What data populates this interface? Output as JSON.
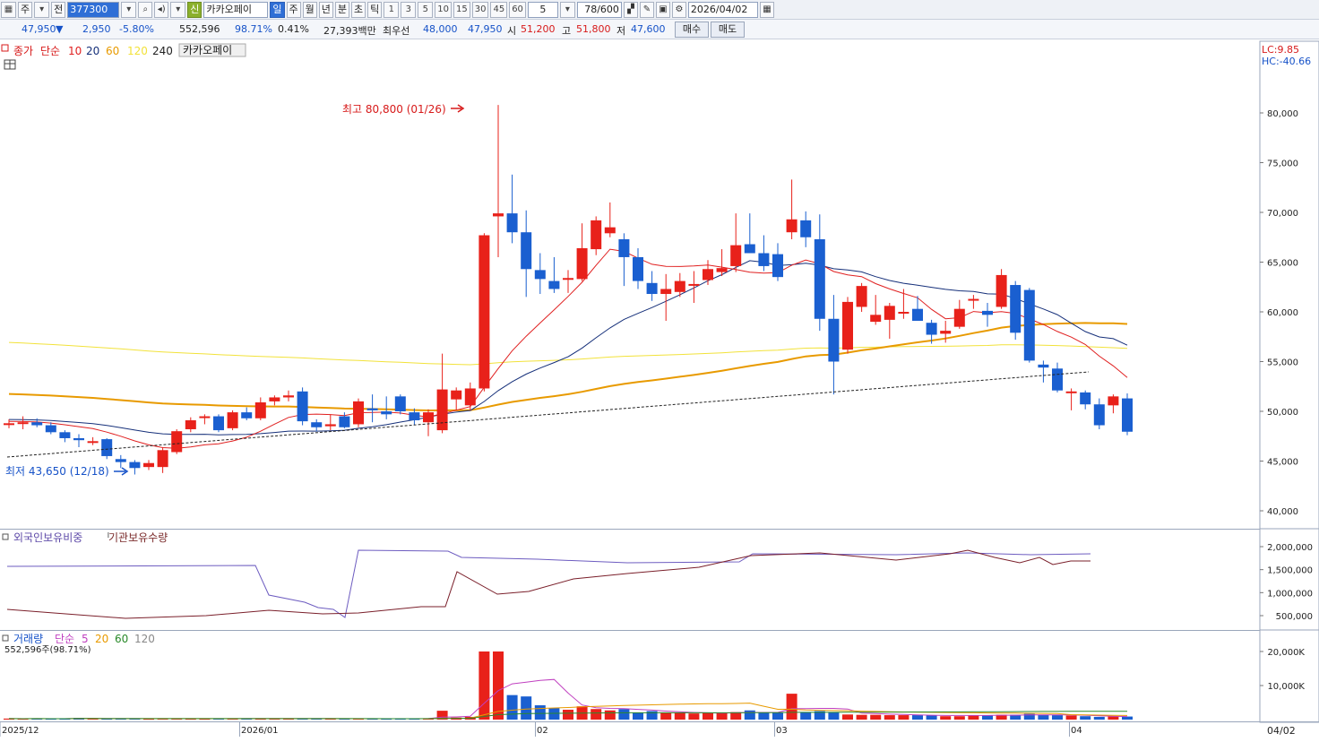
{
  "toolbar": {
    "type_select": "주",
    "scope_select": "전",
    "code": "377300",
    "stock_badge": "신",
    "stock_name": "카카오페이",
    "periods": [
      "일",
      "주",
      "월",
      "년",
      "분",
      "초",
      "틱"
    ],
    "active_period": "일",
    "intervals": [
      "1",
      "3",
      "5",
      "10",
      "15",
      "30",
      "45",
      "60"
    ],
    "interval_value": "5",
    "zoom": "78/600",
    "date": "2026/04/02"
  },
  "quote": {
    "price": "47,950",
    "direction": "▼",
    "change": "2,950",
    "change_pct": "-5.80%",
    "volume": "552,596",
    "volume_ratio": "98.71%",
    "turnover_pct": "0.41%",
    "amount": "27,393백만",
    "best_bid_label": "최우선",
    "best_ask": "48,000",
    "best_bid": "47,950",
    "open_label": "시",
    "open": "51,200",
    "high_label": "고",
    "high": "51,800",
    "low_label": "저",
    "low": "47,600",
    "buy_label": "매수",
    "sell_label": "매도"
  },
  "price_panel": {
    "legend_close": "종가",
    "legend_simple": "단순",
    "ma_labels": [
      "10",
      "20",
      "60",
      "120",
      "240"
    ],
    "stock_label": "카카오페이",
    "lc": "LC:9.85",
    "hc": "HC:-40.66",
    "high_annotation": "최고 80,800 (01/26)",
    "low_annotation": "최저 43,650 (12/18)",
    "ma_colors": {
      "10": "#e02020",
      "20": "#16307a",
      "60": "#e89a00",
      "120": "#f2e23a",
      "240": "#222222"
    }
  },
  "foreign_panel": {
    "legend1": "외국인보유비중",
    "legend2": "기관보유수량",
    "y_ticks": [
      "2,000,000",
      "1,500,000",
      "1,000,000",
      "500,000"
    ]
  },
  "volume_panel": {
    "legend_volume": "거래량",
    "legend_simple": "단순",
    "ma_labels": [
      "5",
      "20",
      "60",
      "120"
    ],
    "volume_info": "552,596주(98.71%)",
    "y_ticks": [
      "20,000K",
      "10,000K"
    ]
  },
  "x_axis": {
    "labels": [
      "2025/12",
      "2026/01",
      "02",
      "03",
      "04",
      "04/02"
    ]
  },
  "chart_data": {
    "type": "candlestick",
    "y_axis_ticks": [
      80000,
      75000,
      70000,
      65000,
      60000,
      55000,
      50000,
      45000,
      40000
    ],
    "ylim": [
      38000,
      82000
    ],
    "candles": [
      {
        "o": 48700,
        "h": 49200,
        "l": 48300,
        "c": 48800
      },
      {
        "o": 48800,
        "h": 49500,
        "l": 48200,
        "c": 48900
      },
      {
        "o": 48900,
        "h": 49300,
        "l": 48400,
        "c": 48600
      },
      {
        "o": 48600,
        "h": 48900,
        "l": 47700,
        "c": 47900
      },
      {
        "o": 47900,
        "h": 48100,
        "l": 46900,
        "c": 47300
      },
      {
        "o": 47300,
        "h": 47700,
        "l": 46400,
        "c": 47100
      },
      {
        "o": 46900,
        "h": 47400,
        "l": 46600,
        "c": 47000
      },
      {
        "o": 47200,
        "h": 47300,
        "l": 45200,
        "c": 45500
      },
      {
        "o": 45200,
        "h": 45600,
        "l": 44300,
        "c": 44900
      },
      {
        "o": 44900,
        "h": 45100,
        "l": 43650,
        "c": 44300
      },
      {
        "o": 44400,
        "h": 45100,
        "l": 44100,
        "c": 44800
      },
      {
        "o": 44400,
        "h": 46400,
        "l": 43800,
        "c": 46100
      },
      {
        "o": 45900,
        "h": 48200,
        "l": 45700,
        "c": 48000
      },
      {
        "o": 48200,
        "h": 49400,
        "l": 47900,
        "c": 49100
      },
      {
        "o": 49400,
        "h": 49700,
        "l": 48700,
        "c": 49500
      },
      {
        "o": 49500,
        "h": 49700,
        "l": 47900,
        "c": 48100
      },
      {
        "o": 48300,
        "h": 50100,
        "l": 48100,
        "c": 49900
      },
      {
        "o": 49900,
        "h": 50400,
        "l": 49100,
        "c": 49300
      },
      {
        "o": 49300,
        "h": 51400,
        "l": 49100,
        "c": 50900
      },
      {
        "o": 51000,
        "h": 51600,
        "l": 50600,
        "c": 51400
      },
      {
        "o": 51400,
        "h": 52100,
        "l": 51000,
        "c": 51600
      },
      {
        "o": 52000,
        "h": 52400,
        "l": 48600,
        "c": 49000
      },
      {
        "o": 48900,
        "h": 49200,
        "l": 48000,
        "c": 48400
      },
      {
        "o": 48500,
        "h": 49700,
        "l": 48100,
        "c": 48700
      },
      {
        "o": 49500,
        "h": 49900,
        "l": 48300,
        "c": 48400
      },
      {
        "o": 48700,
        "h": 51300,
        "l": 48400,
        "c": 51000
      },
      {
        "o": 50300,
        "h": 51700,
        "l": 48900,
        "c": 50100
      },
      {
        "o": 50000,
        "h": 51500,
        "l": 49200,
        "c": 49700
      },
      {
        "o": 51500,
        "h": 51700,
        "l": 49700,
        "c": 50000
      },
      {
        "o": 49900,
        "h": 50300,
        "l": 48600,
        "c": 49100
      },
      {
        "o": 48900,
        "h": 50200,
        "l": 47500,
        "c": 49900
      },
      {
        "o": 48100,
        "h": 55800,
        "l": 47800,
        "c": 52200
      },
      {
        "o": 51200,
        "h": 52400,
        "l": 50100,
        "c": 52100
      },
      {
        "o": 50600,
        "h": 52900,
        "l": 50100,
        "c": 52300
      },
      {
        "o": 52300,
        "h": 67900,
        "l": 52000,
        "c": 67700
      },
      {
        "o": 69600,
        "h": 80800,
        "l": 65500,
        "c": 69900
      },
      {
        "o": 69900,
        "h": 73800,
        "l": 66900,
        "c": 68000
      },
      {
        "o": 68000,
        "h": 70200,
        "l": 61500,
        "c": 64300
      },
      {
        "o": 64200,
        "h": 65900,
        "l": 61800,
        "c": 63300
      },
      {
        "o": 63100,
        "h": 65500,
        "l": 61900,
        "c": 62300
      },
      {
        "o": 63300,
        "h": 64200,
        "l": 61900,
        "c": 63400
      },
      {
        "o": 63300,
        "h": 68900,
        "l": 63100,
        "c": 66400
      },
      {
        "o": 66300,
        "h": 69600,
        "l": 65700,
        "c": 69200
      },
      {
        "o": 67900,
        "h": 71000,
        "l": 67500,
        "c": 68500
      },
      {
        "o": 67300,
        "h": 67900,
        "l": 62600,
        "c": 65500
      },
      {
        "o": 65500,
        "h": 66400,
        "l": 62300,
        "c": 63100
      },
      {
        "o": 62900,
        "h": 64100,
        "l": 61100,
        "c": 61800
      },
      {
        "o": 61800,
        "h": 63800,
        "l": 59100,
        "c": 62300
      },
      {
        "o": 62000,
        "h": 63900,
        "l": 61500,
        "c": 63100
      },
      {
        "o": 62800,
        "h": 64100,
        "l": 60900,
        "c": 62800
      },
      {
        "o": 63200,
        "h": 65200,
        "l": 62700,
        "c": 64300
      },
      {
        "o": 64000,
        "h": 66300,
        "l": 63600,
        "c": 64400
      },
      {
        "o": 64600,
        "h": 69900,
        "l": 64000,
        "c": 66700
      },
      {
        "o": 66800,
        "h": 69900,
        "l": 66300,
        "c": 65900
      },
      {
        "o": 65900,
        "h": 67700,
        "l": 64100,
        "c": 64600
      },
      {
        "o": 65800,
        "h": 66900,
        "l": 63100,
        "c": 63500
      },
      {
        "o": 68000,
        "h": 73300,
        "l": 67300,
        "c": 69300
      },
      {
        "o": 69200,
        "h": 70100,
        "l": 66500,
        "c": 67500
      },
      {
        "o": 67300,
        "h": 69800,
        "l": 58100,
        "c": 59300
      },
      {
        "o": 59300,
        "h": 61700,
        "l": 51700,
        "c": 55000
      },
      {
        "o": 56200,
        "h": 61500,
        "l": 55800,
        "c": 61000
      },
      {
        "o": 60500,
        "h": 62900,
        "l": 60000,
        "c": 62600
      },
      {
        "o": 59000,
        "h": 61700,
        "l": 58700,
        "c": 59700
      },
      {
        "o": 59200,
        "h": 60900,
        "l": 57300,
        "c": 60600
      },
      {
        "o": 59900,
        "h": 62300,
        "l": 59300,
        "c": 60000
      },
      {
        "o": 60300,
        "h": 61600,
        "l": 59200,
        "c": 59100
      },
      {
        "o": 58900,
        "h": 59200,
        "l": 56800,
        "c": 57700
      },
      {
        "o": 57800,
        "h": 59100,
        "l": 56900,
        "c": 58100
      },
      {
        "o": 58500,
        "h": 61200,
        "l": 58300,
        "c": 60300
      },
      {
        "o": 61300,
        "h": 61700,
        "l": 60300,
        "c": 61300
      },
      {
        "o": 60100,
        "h": 60900,
        "l": 58500,
        "c": 59700
      },
      {
        "o": 60500,
        "h": 64300,
        "l": 60300,
        "c": 63700
      },
      {
        "o": 62700,
        "h": 63100,
        "l": 57200,
        "c": 57900
      },
      {
        "o": 62200,
        "h": 62400,
        "l": 54900,
        "c": 55100
      },
      {
        "o": 54700,
        "h": 55100,
        "l": 52900,
        "c": 54400
      },
      {
        "o": 54300,
        "h": 54900,
        "l": 51900,
        "c": 52100
      },
      {
        "o": 51900,
        "h": 52300,
        "l": 50100,
        "c": 52000
      },
      {
        "o": 51900,
        "h": 52100,
        "l": 50200,
        "c": 50700
      },
      {
        "o": 50700,
        "h": 51300,
        "l": 48200,
        "c": 48600
      },
      {
        "o": 50600,
        "h": 51700,
        "l": 49800,
        "c": 51500
      },
      {
        "o": 51300,
        "h": 51800,
        "l": 47600,
        "c": 47950
      }
    ],
    "volumes_k": [
      300,
      250,
      280,
      260,
      280,
      500,
      300,
      240,
      260,
      280,
      220,
      260,
      320,
      240,
      230,
      260,
      280,
      300,
      250,
      320,
      300,
      280,
      270,
      260,
      240,
      260,
      240,
      250,
      260,
      280,
      300,
      2600,
      600,
      800,
      20000,
      20000,
      7200,
      6800,
      4200,
      3400,
      2900,
      3900,
      3100,
      2700,
      3100,
      2100,
      2500,
      2000,
      2100,
      1800,
      2000,
      1900,
      2200,
      2700,
      2000,
      2100,
      7600,
      2100,
      2500,
      2100,
      1500,
      1400,
      1400,
      1300,
      1300,
      1300,
      1200,
      1000,
      1000,
      1200,
      1200,
      1400,
      1400,
      1700,
      1400,
      1300,
      1200,
      1000,
      800,
      900,
      900
    ],
    "volume_ma5_k": [
      280,
      270,
      275,
      272,
      275,
      320,
      320,
      300,
      290,
      290,
      270,
      260,
      270,
      270,
      260,
      260,
      270,
      280,
      280,
      290,
      300,
      290,
      290,
      280,
      270,
      270,
      260,
      260,
      260,
      260,
      280,
      730,
      800,
      1000,
      4800,
      8500,
      10500,
      11000,
      11500,
      11800,
      7800,
      4300,
      3500,
      3300,
      3200,
      3000,
      2800,
      2500,
      2300,
      2100,
      2000,
      1900,
      2000,
      2100,
      2100,
      2100,
      3200,
      3200,
      3300,
      3300,
      3100,
      1900,
      1800,
      1600,
      1500,
      1400,
      1300,
      1200,
      1200,
      1200,
      1200,
      1300,
      1300,
      1400,
      1400,
      1400,
      1400,
      1300,
      1100,
      1000,
      900
    ]
  }
}
